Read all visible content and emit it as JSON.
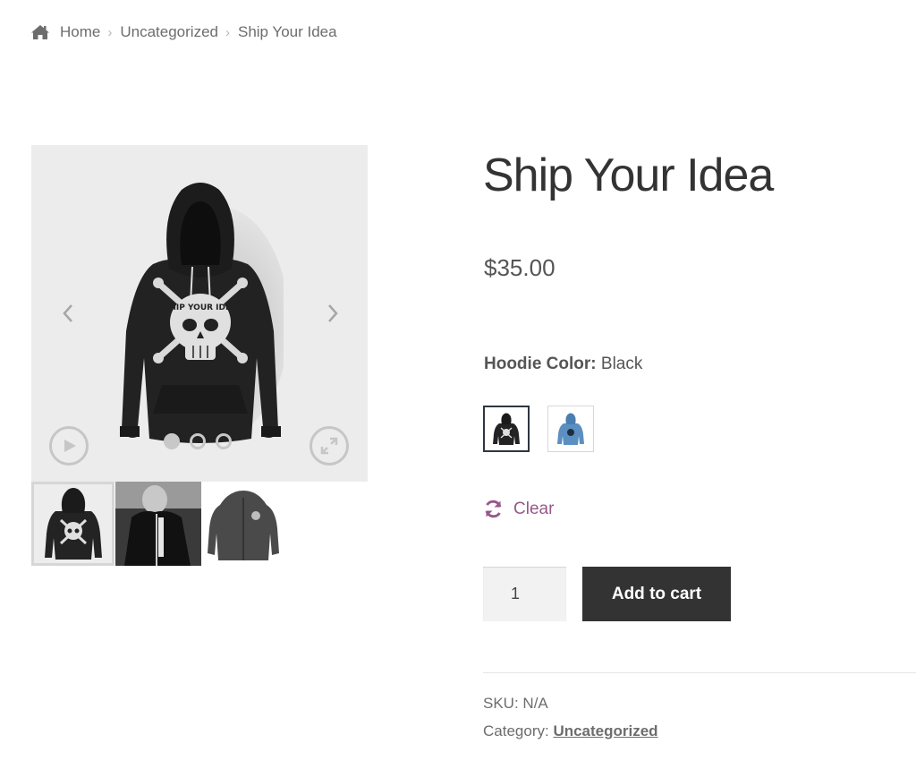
{
  "breadcrumb": {
    "home": "Home",
    "category": "Uncategorized",
    "current": "Ship Your Idea"
  },
  "gallery": {
    "slides_count": 3,
    "active_slide": 1,
    "hoodie_print_text": "SHIP YOUR IDEA"
  },
  "product": {
    "title": "Ship Your Idea",
    "price": "$35.00",
    "variation": {
      "label": "Hoodie Color",
      "separator": ":",
      "selected_value": "Black",
      "options": [
        "Black",
        "Blue"
      ]
    },
    "clear_label": "Clear",
    "quantity": "1",
    "add_to_cart_label": "Add to cart",
    "sku_label": "SKU:",
    "sku_value": "N/A",
    "category_label": "Category:",
    "category_value": "Uncategorized"
  },
  "colors": {
    "accent": "#96588a",
    "button": "#333333",
    "text": "#43454b"
  }
}
